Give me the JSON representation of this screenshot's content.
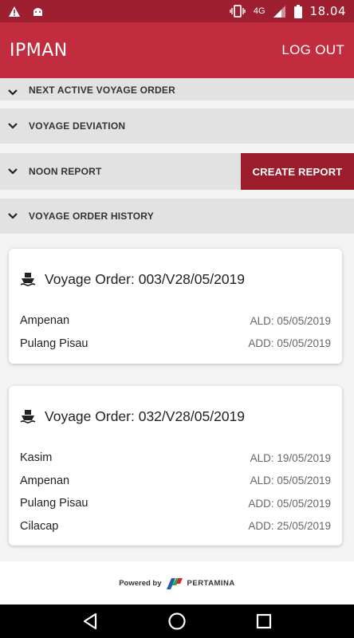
{
  "status_bar": {
    "warning_icon": "warning-icon",
    "app_notification_icon": "android-icon",
    "vibrate_icon": "vibrate-icon",
    "network": "4G",
    "signal_icon": "signal-icon",
    "battery_icon": "battery-icon",
    "time": "18.04"
  },
  "header": {
    "title": "IPMAN",
    "logout_label": "LOG OUT"
  },
  "sections": {
    "next_active": "NEXT ACTIVE VOYAGE ORDER",
    "deviation": "VOYAGE DEVIATION",
    "noon_report": "NOON REPORT",
    "create_report_label": "CREATE REPORT",
    "history": "VOYAGE ORDER HISTORY"
  },
  "voyages": [
    {
      "title": "Voyage Order: 003/V28/05/2019",
      "ports": [
        {
          "name": "Ampenan",
          "date": "ALD: 05/05/2019"
        },
        {
          "name": "Pulang Pisau",
          "date": "ADD: 05/05/2019"
        }
      ]
    },
    {
      "title": "Voyage Order: 032/V28/05/2019",
      "ports": [
        {
          "name": "Kasim",
          "date": "ALD: 19/05/2019"
        },
        {
          "name": "Ampenan",
          "date": "ALD: 05/05/2019"
        },
        {
          "name": "Pulang Pisau",
          "date": "ADD: 05/05/2019"
        },
        {
          "name": "Cilacap",
          "date": "ADD: 25/05/2019"
        }
      ]
    }
  ],
  "footer": {
    "powered_by": "Powered by",
    "brand": "PERTAMINA"
  },
  "colors": {
    "status_bar": "#9e1f2f",
    "app_bar": "#c12c3f",
    "create_report": "#9b1d2c",
    "section_bg": "#e2e2e2"
  }
}
